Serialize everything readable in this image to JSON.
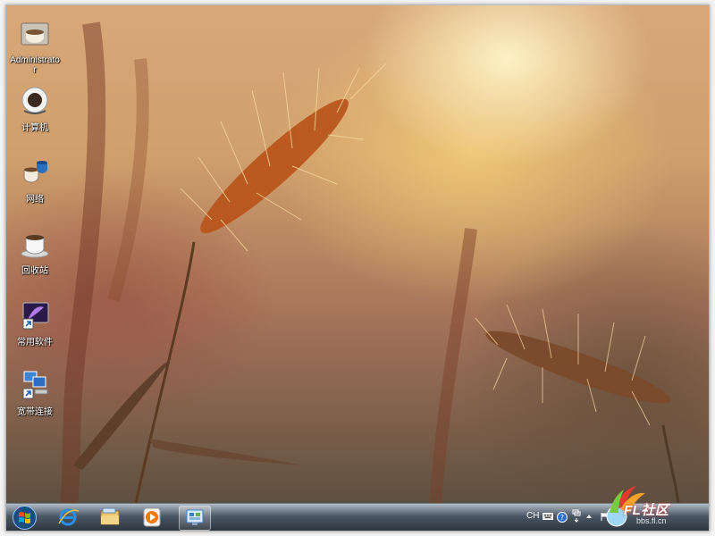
{
  "desktop": {
    "icons": [
      {
        "label": "Administrator",
        "icon": "user-folder-icon"
      },
      {
        "label": "计算机",
        "icon": "computer-icon"
      },
      {
        "label": "网络",
        "icon": "network-icon"
      },
      {
        "label": "回收站",
        "icon": "recycle-bin-icon"
      },
      {
        "label": "常用软件",
        "icon": "software-shortcut-icon"
      },
      {
        "label": "宽带连接",
        "icon": "broadband-connection-icon"
      }
    ],
    "wallpaper": "golden wheat grass"
  },
  "taskbar": {
    "start": "start-orb-icon",
    "pinned": [
      "internet-explorer-icon",
      "file-explorer-icon",
      "media-player-icon",
      "control-panel-icon"
    ],
    "active_index": 3
  },
  "tray": {
    "language": "CH",
    "icons": [
      "keyboard-icon",
      "help-icon",
      "notification-icon",
      "expand-arrow-icon",
      "flag-icon"
    ]
  },
  "watermark": {
    "text": "FL社区",
    "url": "bbs.fl.cn"
  },
  "colors": {
    "taskbar": "#1f2b38",
    "accent": "#e8b060"
  }
}
